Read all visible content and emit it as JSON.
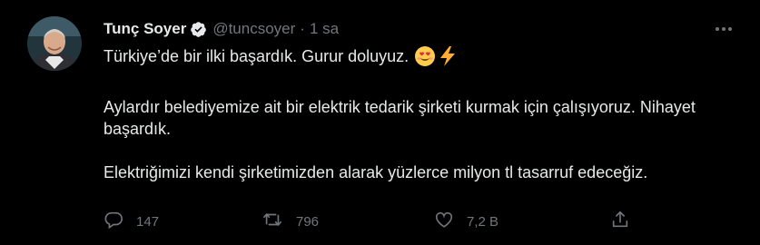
{
  "tweet": {
    "author_name": "Tunç Soyer",
    "handle": "@tuncsoyer",
    "separator": "·",
    "time": "1 sa",
    "verified": true,
    "text_line1": "Türkiye’de bir ilki başardık. Gurur doluyuz.",
    "line1_emojis": [
      "smiling-face-with-heart-eyes",
      "high-voltage"
    ],
    "paragraph2": "Aylardır belediyemize ait bir elektrik tedarik şirketi kurmak için çalışıyoruz. Nihayet başardık.",
    "paragraph3": "Elektriğimizi kendi şirketimizden alarak yüzlerce milyon tl tasarruf edeceğiz."
  },
  "actions": {
    "reply_count": "147",
    "retweet_count": "796",
    "like_count": "7,2 B",
    "icons": [
      "reply-icon",
      "retweet-icon",
      "like-icon",
      "share-icon"
    ]
  },
  "colors": {
    "background": "#000000",
    "text": "#e7e9ea",
    "muted": "#71767b",
    "verified": "#e7e9ea"
  }
}
